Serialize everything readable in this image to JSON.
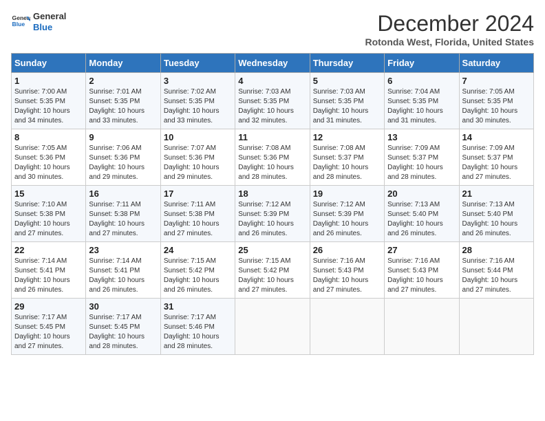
{
  "logo": {
    "line1": "General",
    "line2": "Blue"
  },
  "title": "December 2024",
  "location": "Rotonda West, Florida, United States",
  "weekdays": [
    "Sunday",
    "Monday",
    "Tuesday",
    "Wednesday",
    "Thursday",
    "Friday",
    "Saturday"
  ],
  "weeks": [
    [
      {
        "day": "1",
        "info": "Sunrise: 7:00 AM\nSunset: 5:35 PM\nDaylight: 10 hours\nand 34 minutes."
      },
      {
        "day": "2",
        "info": "Sunrise: 7:01 AM\nSunset: 5:35 PM\nDaylight: 10 hours\nand 33 minutes."
      },
      {
        "day": "3",
        "info": "Sunrise: 7:02 AM\nSunset: 5:35 PM\nDaylight: 10 hours\nand 33 minutes."
      },
      {
        "day": "4",
        "info": "Sunrise: 7:03 AM\nSunset: 5:35 PM\nDaylight: 10 hours\nand 32 minutes."
      },
      {
        "day": "5",
        "info": "Sunrise: 7:03 AM\nSunset: 5:35 PM\nDaylight: 10 hours\nand 31 minutes."
      },
      {
        "day": "6",
        "info": "Sunrise: 7:04 AM\nSunset: 5:35 PM\nDaylight: 10 hours\nand 31 minutes."
      },
      {
        "day": "7",
        "info": "Sunrise: 7:05 AM\nSunset: 5:35 PM\nDaylight: 10 hours\nand 30 minutes."
      }
    ],
    [
      {
        "day": "8",
        "info": "Sunrise: 7:05 AM\nSunset: 5:36 PM\nDaylight: 10 hours\nand 30 minutes."
      },
      {
        "day": "9",
        "info": "Sunrise: 7:06 AM\nSunset: 5:36 PM\nDaylight: 10 hours\nand 29 minutes."
      },
      {
        "day": "10",
        "info": "Sunrise: 7:07 AM\nSunset: 5:36 PM\nDaylight: 10 hours\nand 29 minutes."
      },
      {
        "day": "11",
        "info": "Sunrise: 7:08 AM\nSunset: 5:36 PM\nDaylight: 10 hours\nand 28 minutes."
      },
      {
        "day": "12",
        "info": "Sunrise: 7:08 AM\nSunset: 5:37 PM\nDaylight: 10 hours\nand 28 minutes."
      },
      {
        "day": "13",
        "info": "Sunrise: 7:09 AM\nSunset: 5:37 PM\nDaylight: 10 hours\nand 28 minutes."
      },
      {
        "day": "14",
        "info": "Sunrise: 7:09 AM\nSunset: 5:37 PM\nDaylight: 10 hours\nand 27 minutes."
      }
    ],
    [
      {
        "day": "15",
        "info": "Sunrise: 7:10 AM\nSunset: 5:38 PM\nDaylight: 10 hours\nand 27 minutes."
      },
      {
        "day": "16",
        "info": "Sunrise: 7:11 AM\nSunset: 5:38 PM\nDaylight: 10 hours\nand 27 minutes."
      },
      {
        "day": "17",
        "info": "Sunrise: 7:11 AM\nSunset: 5:38 PM\nDaylight: 10 hours\nand 27 minutes."
      },
      {
        "day": "18",
        "info": "Sunrise: 7:12 AM\nSunset: 5:39 PM\nDaylight: 10 hours\nand 26 minutes."
      },
      {
        "day": "19",
        "info": "Sunrise: 7:12 AM\nSunset: 5:39 PM\nDaylight: 10 hours\nand 26 minutes."
      },
      {
        "day": "20",
        "info": "Sunrise: 7:13 AM\nSunset: 5:40 PM\nDaylight: 10 hours\nand 26 minutes."
      },
      {
        "day": "21",
        "info": "Sunrise: 7:13 AM\nSunset: 5:40 PM\nDaylight: 10 hours\nand 26 minutes."
      }
    ],
    [
      {
        "day": "22",
        "info": "Sunrise: 7:14 AM\nSunset: 5:41 PM\nDaylight: 10 hours\nand 26 minutes."
      },
      {
        "day": "23",
        "info": "Sunrise: 7:14 AM\nSunset: 5:41 PM\nDaylight: 10 hours\nand 26 minutes."
      },
      {
        "day": "24",
        "info": "Sunrise: 7:15 AM\nSunset: 5:42 PM\nDaylight: 10 hours\nand 26 minutes."
      },
      {
        "day": "25",
        "info": "Sunrise: 7:15 AM\nSunset: 5:42 PM\nDaylight: 10 hours\nand 27 minutes."
      },
      {
        "day": "26",
        "info": "Sunrise: 7:16 AM\nSunset: 5:43 PM\nDaylight: 10 hours\nand 27 minutes."
      },
      {
        "day": "27",
        "info": "Sunrise: 7:16 AM\nSunset: 5:43 PM\nDaylight: 10 hours\nand 27 minutes."
      },
      {
        "day": "28",
        "info": "Sunrise: 7:16 AM\nSunset: 5:44 PM\nDaylight: 10 hours\nand 27 minutes."
      }
    ],
    [
      {
        "day": "29",
        "info": "Sunrise: 7:17 AM\nSunset: 5:45 PM\nDaylight: 10 hours\nand 27 minutes."
      },
      {
        "day": "30",
        "info": "Sunrise: 7:17 AM\nSunset: 5:45 PM\nDaylight: 10 hours\nand 28 minutes."
      },
      {
        "day": "31",
        "info": "Sunrise: 7:17 AM\nSunset: 5:46 PM\nDaylight: 10 hours\nand 28 minutes."
      },
      {
        "day": "",
        "info": ""
      },
      {
        "day": "",
        "info": ""
      },
      {
        "day": "",
        "info": ""
      },
      {
        "day": "",
        "info": ""
      }
    ]
  ]
}
